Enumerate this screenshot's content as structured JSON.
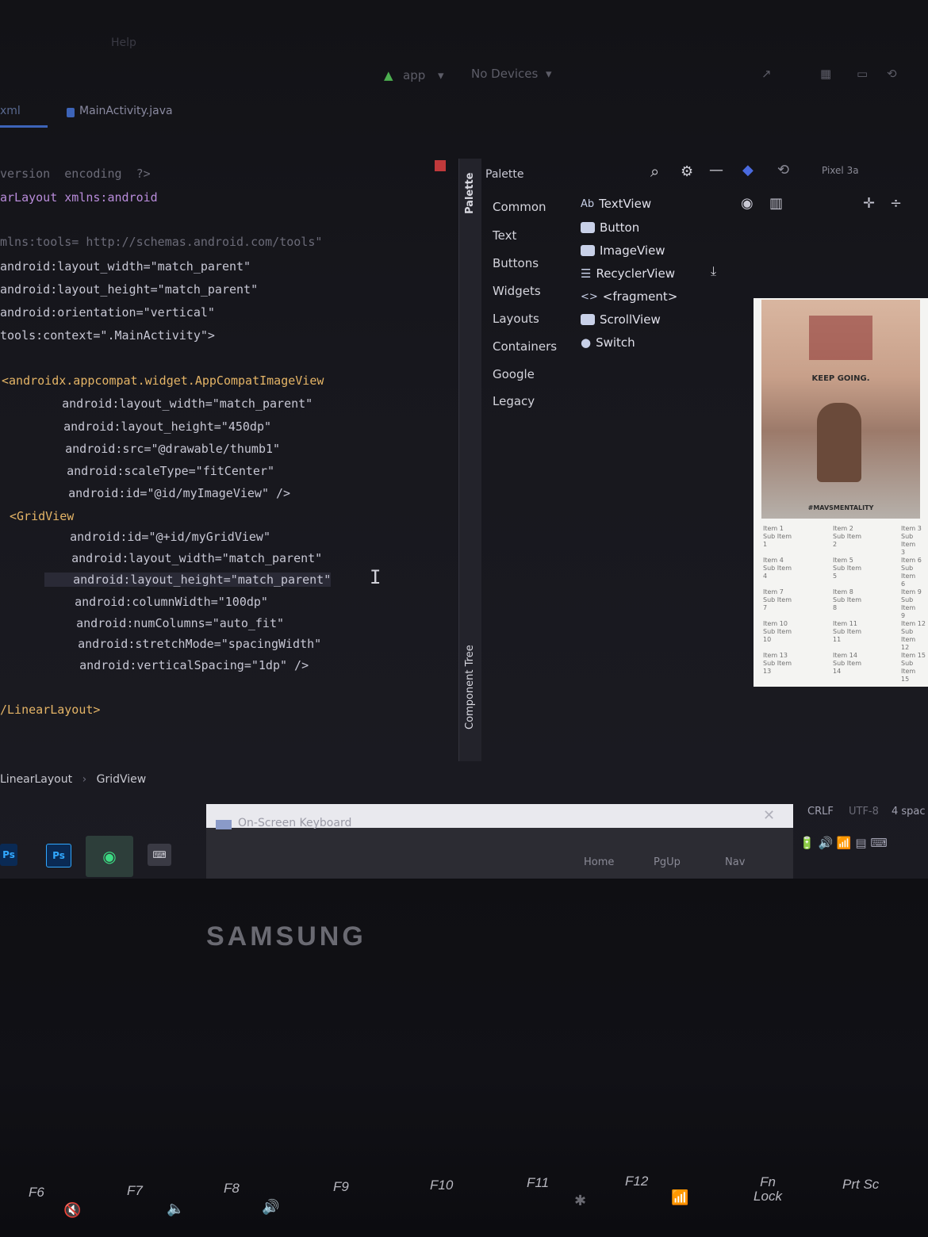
{
  "toolbar": {
    "menu_item": "Help",
    "run_config": "app",
    "device_selector": "No Devices"
  },
  "tabs": [
    {
      "label": "xml"
    },
    {
      "label": "MainActivity.java"
    }
  ],
  "code_lines": [
    "version  encoding  ?>",
    "arLayout xmlns:android",
    "",
    "mlns:tools= http://schemas.android.com/tools\"",
    "android:layout_width=\"match_parent\"",
    "android:layout_height=\"match_parent\"",
    "android:orientation=\"vertical\"",
    "tools:context=\".MainActivity\">",
    "",
    "<androidx.appcompat.widget.AppCompatImageView",
    "    android:layout_width=\"match_parent\"",
    "    android:layout_height=\"450dp\"",
    "    android:src=\"@drawable/thumb1\"",
    "    android:scaleType=\"fitCenter\"",
    "    android:id=\"@id/myImageView\" />",
    "<GridView",
    "    android:id=\"@+id/myGridView\"",
    "    android:layout_width=\"match_parent\"",
    "    android:layout_height=\"match_parent\"",
    "    android:columnWidth=\"100dp\"",
    "    android:numColumns=\"auto_fit\"",
    "    android:stretchMode=\"spacingWidth\"",
    "    android:verticalSpacing=\"1dp\" />",
    "",
    "/LinearLayout>"
  ],
  "breadcrumb": {
    "parent": "LinearLayout",
    "child": "GridView"
  },
  "palette": {
    "title": "Palette",
    "side_label": "Palette",
    "component_tree_label": "Component Tree",
    "categories": [
      "Common",
      "Text",
      "Buttons",
      "Widgets",
      "Layouts",
      "Containers",
      "Google",
      "Legacy"
    ],
    "items": [
      {
        "label": "TextView",
        "icon": "textview-icon"
      },
      {
        "label": "Button",
        "icon": "button-icon"
      },
      {
        "label": "ImageView",
        "icon": "imageview-icon"
      },
      {
        "label": "RecyclerView",
        "icon": "list-icon"
      },
      {
        "label": "<fragment>",
        "icon": "code-icon"
      },
      {
        "label": "ScrollView",
        "icon": "scrollview-icon"
      },
      {
        "label": "Switch",
        "icon": "switch-icon"
      }
    ]
  },
  "preview": {
    "device_label": "Pixel 3a",
    "poster_lines": [
      "KEEP GOING.",
      "#MAVSMENTALITY"
    ],
    "grid_items": [
      [
        "Item 1",
        "Sub Item",
        "1"
      ],
      [
        "Item 2",
        "Sub Item",
        "2"
      ],
      [
        "Item 3",
        "Sub Item",
        "3"
      ],
      [
        "Item 4",
        "Sub Item",
        "4"
      ],
      [
        "Item 5",
        "Sub Item",
        "5"
      ],
      [
        "Item 6",
        "Sub Item",
        "6"
      ],
      [
        "Item 7",
        "Sub Item",
        "7"
      ],
      [
        "Item 8",
        "Sub Item",
        "8"
      ],
      [
        "Item 9",
        "Sub Item",
        "9"
      ],
      [
        "Item 10",
        "Sub Item",
        "10"
      ],
      [
        "Item 11",
        "Sub Item",
        "11"
      ],
      [
        "Item 12",
        "Sub Item",
        "12"
      ],
      [
        "Item 13",
        "Sub Item",
        "13"
      ],
      [
        "Item 14",
        "Sub Item",
        "14"
      ],
      [
        "Item 15",
        "Sub Item",
        "15"
      ]
    ]
  },
  "status": {
    "line_sep": "CRLF",
    "encoding": "UTF-8",
    "indent": "4 spac"
  },
  "osk": {
    "title": "On-Screen Keyboard",
    "keys": [
      "Home",
      "PgUp",
      "Nav"
    ]
  },
  "taskbar": [
    "Ps",
    "Ps",
    "Android Studio",
    "Keyboard"
  ],
  "laptop": {
    "brand": "SAMSUNG",
    "fkeys": [
      "F6",
      "F7",
      "F8",
      "F9",
      "F10",
      "F11",
      "F12",
      "Fn Lock",
      "Prt Sc"
    ]
  }
}
